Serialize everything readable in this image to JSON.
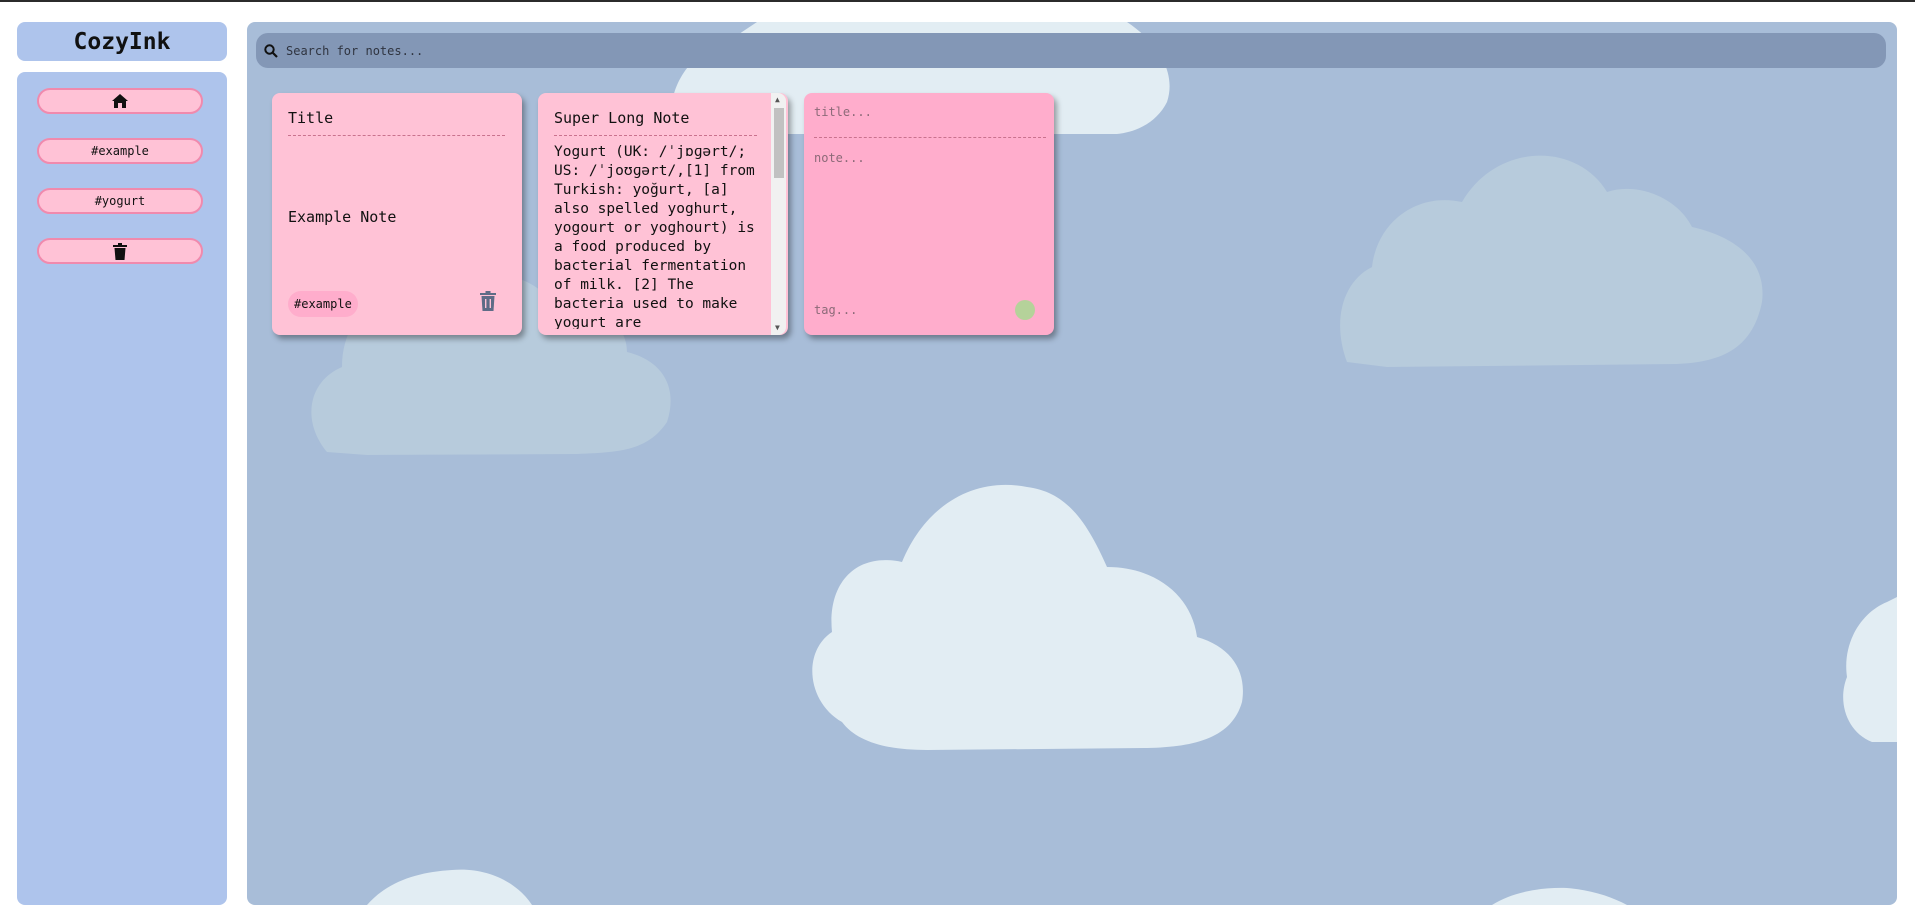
{
  "app": {
    "title": "CozyInk"
  },
  "sidebar": {
    "items": [
      {
        "label": "",
        "icon": "home-icon"
      },
      {
        "label": "#example"
      },
      {
        "label": "#yogurt"
      },
      {
        "label": "",
        "icon": "trash-icon"
      }
    ]
  },
  "search": {
    "placeholder": "Search for notes...",
    "value": ""
  },
  "notes": [
    {
      "title": "Title",
      "body": "Example Note",
      "tag": "#example"
    },
    {
      "title": "Super Long Note",
      "body": "Yogurt (UK: /ˈjɒɡərt/; US: /ˈjoʊɡərt/,[1] from Turkish: yoğurt, [a] also spelled yoghurt, yogourt or yoghourt) is a food produced by bacterial fermentation of milk. [2] The bacteria used to make yogurt are"
    }
  ],
  "new_note": {
    "title_placeholder": "title...",
    "note_placeholder": "note...",
    "tag_placeholder": "tag..."
  },
  "colors": {
    "sidebar_bg": "#aec4ec",
    "main_bg": "#a8bdd8",
    "note_bg": "#ffc2d6",
    "new_note_bg": "#ffadcc",
    "add_button": "#b5d29a",
    "search_bg": "#8397b6"
  }
}
